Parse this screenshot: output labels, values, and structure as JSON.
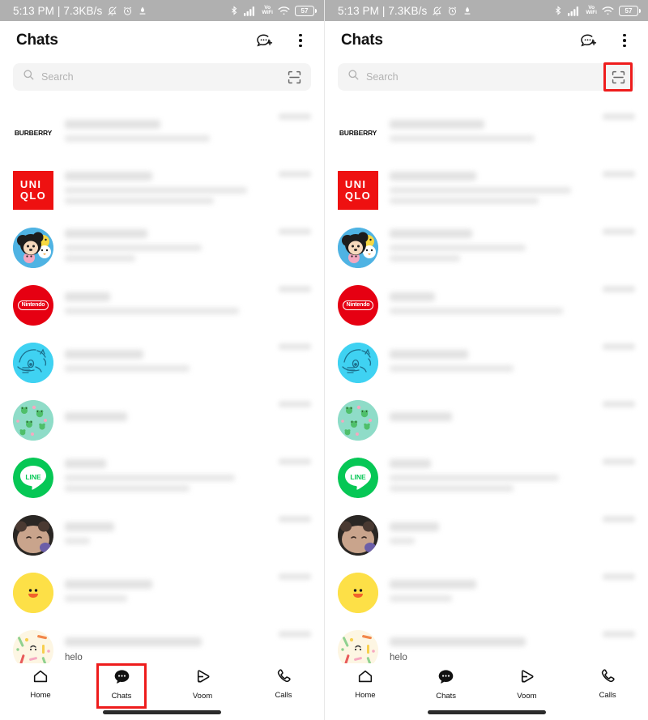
{
  "meta": {
    "app": "LINE",
    "colors": {
      "statusbar_bg": "#b0b0b0",
      "highlight_red": "#ee1c1c",
      "line_green": "#06c755",
      "uniqlo_red": "#ee1111",
      "nintendo_red": "#e60012",
      "search_bg": "#f4f4f4"
    }
  },
  "statusbar": {
    "time": "5:13 PM",
    "separator": "|",
    "network_speed": "7.3KB/s",
    "icons_left": [
      "mute-bell-icon",
      "alarm-clock-icon",
      "download-icon"
    ],
    "icons_right": [
      "bluetooth-icon",
      "signal-bars-icon",
      "vowifi-icon",
      "wifi-icon",
      "battery-icon"
    ],
    "vowifi_top": "Vo",
    "vowifi_bottom": "WiFi",
    "battery_level": "57"
  },
  "header": {
    "title": "Chats",
    "new_chat_icon": "new-chat-icon",
    "more_icon": "more-options-icon"
  },
  "search": {
    "placeholder": "Search",
    "search_icon": "search-icon",
    "scan_icon": "qr-scan-icon"
  },
  "chats": [
    {
      "avatar": "burberry-logo",
      "logo_text": "BURBERRY",
      "name": "",
      "message": "",
      "time": ""
    },
    {
      "avatar": "uniqlo-logo",
      "logo_line1": "UNI",
      "logo_line2": "QLO",
      "name": "",
      "message": "",
      "time": ""
    },
    {
      "avatar": "tsum-tsum-photo",
      "name": "",
      "message": "",
      "time": ""
    },
    {
      "avatar": "nintendo-logo",
      "logo_text": "Nintendo",
      "name": "",
      "message": "",
      "time": ""
    },
    {
      "avatar": "doraemon-photo",
      "name": "",
      "message": "",
      "time": ""
    },
    {
      "avatar": "frog-pattern-photo",
      "name": "",
      "message": "",
      "time": ""
    },
    {
      "avatar": "line-logo",
      "logo_text": "LINE",
      "name": "",
      "message": "",
      "time": ""
    },
    {
      "avatar": "brown-bear-photo",
      "name": "",
      "message": "",
      "time": ""
    },
    {
      "avatar": "sally-duck-photo",
      "name": "",
      "message": "",
      "time": ""
    },
    {
      "avatar": "stationery-pattern-photo",
      "name": "",
      "message": "helo",
      "time": ""
    }
  ],
  "bottomnav": {
    "items": [
      {
        "label": "Home",
        "icon": "home-icon"
      },
      {
        "label": "Chats",
        "icon": "chats-icon"
      },
      {
        "label": "Voom",
        "icon": "voom-play-icon"
      },
      {
        "label": "Calls",
        "icon": "phone-icon"
      }
    ],
    "active_index": 1
  },
  "annotations": {
    "left_panel_highlight": "chats-tab-highlight",
    "right_panel_highlight": "qr-scan-button-highlight"
  }
}
